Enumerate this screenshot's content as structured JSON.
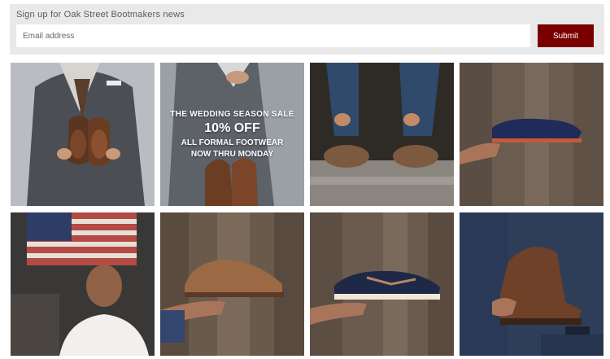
{
  "signup": {
    "title": "Sign up for Oak Street Bootmakers news",
    "email_placeholder": "Email address",
    "submit_label": "Submit"
  },
  "promo": {
    "line1": "THE WEDDING SEASON SALE",
    "line2": "10% OFF",
    "line3": "ALL FORMAL FOOTWEAR",
    "line4": "NOW THRU MONDAY"
  },
  "colors": {
    "submit_bg": "#7a0000",
    "signup_bg": "#e9e9e9"
  },
  "tiles": [
    {
      "name": "man-suit-holding-brown-shoes-image"
    },
    {
      "name": "wedding-sale-promo-image"
    },
    {
      "name": "man-tying-boots-image"
    },
    {
      "name": "navy-boat-shoe-image"
    },
    {
      "name": "craftsman-portrait-image"
    },
    {
      "name": "brown-oxford-shoe-image"
    },
    {
      "name": "navy-camp-moc-image"
    },
    {
      "name": "brown-leather-boot-image"
    }
  ]
}
